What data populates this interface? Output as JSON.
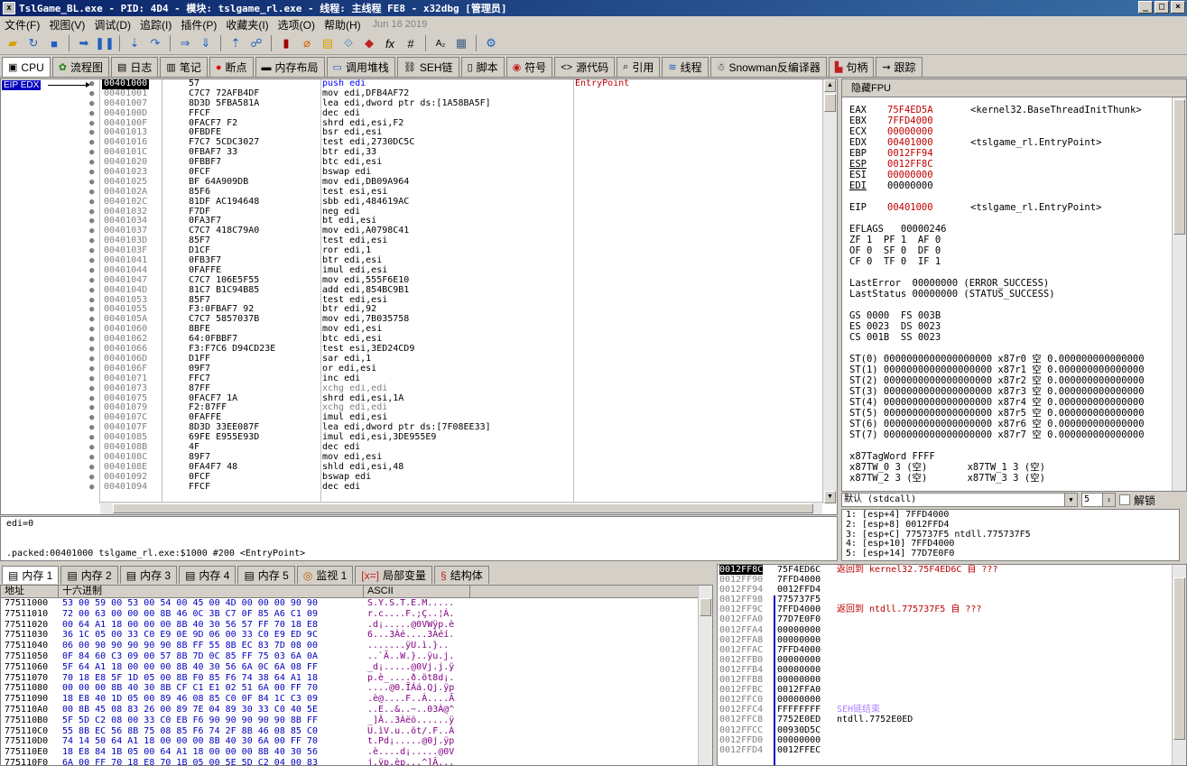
{
  "title": "TslGame_BL.exe - PID: 4D4 - 模块: tslgame_rl.exe - 线程: 主线程 FE8 - x32dbg [管理员]",
  "menu": [
    "文件(F)",
    "视图(V)",
    "调试(D)",
    "追踪(I)",
    "插件(P)",
    "收藏夹(I)",
    "选项(O)",
    "帮助(H)"
  ],
  "menu_date": "Jun 16 2019",
  "tabs": [
    {
      "label": "CPU",
      "icon": "cpu-icon"
    },
    {
      "label": "流程图",
      "icon": "graph-icon"
    },
    {
      "label": "日志",
      "icon": "log-icon"
    },
    {
      "label": "笔记",
      "icon": "notes-icon"
    },
    {
      "label": "断点",
      "icon": "breakpoint-icon"
    },
    {
      "label": "内存布局",
      "icon": "memory-map-icon"
    },
    {
      "label": "调用堆栈",
      "icon": "callstack-icon"
    },
    {
      "label": "SEH链",
      "icon": "seh-icon"
    },
    {
      "label": "脚本",
      "icon": "script-icon"
    },
    {
      "label": "符号",
      "icon": "symbols-icon"
    },
    {
      "label": "源代码",
      "icon": "source-icon"
    },
    {
      "label": "引用",
      "icon": "references-icon"
    },
    {
      "label": "线程",
      "icon": "threads-icon"
    },
    {
      "label": "Snowman反编译器",
      "icon": "snowman-icon"
    },
    {
      "label": "句柄",
      "icon": "handles-icon"
    },
    {
      "label": "跟踪",
      "icon": "trace-icon"
    }
  ],
  "disasm": {
    "eip_label": "EIP EDX",
    "rows": [
      [
        "00401000",
        "57",
        "push edi",
        "EntryPoint"
      ],
      [
        "00401001",
        "C7C7 72AFB4DF",
        "mov edi,DFB4AF72",
        ""
      ],
      [
        "00401007",
        "8D3D 5FBA581A",
        "lea edi,dword ptr ds:[1A58BA5F]",
        ""
      ],
      [
        "0040100D",
        "FFCF",
        "dec edi",
        ""
      ],
      [
        "0040100F",
        "0FACF7 F2",
        "shrd edi,esi,F2",
        ""
      ],
      [
        "00401013",
        "0FBDFE",
        "bsr edi,esi",
        ""
      ],
      [
        "00401016",
        "F7C7 5CDC3027",
        "test edi,2730DC5C",
        ""
      ],
      [
        "0040101C",
        "0FBAF7 33",
        "btr edi,33",
        ""
      ],
      [
        "00401020",
        "0FBBF7",
        "btc edi,esi",
        ""
      ],
      [
        "00401023",
        "0FCF",
        "bswap edi",
        ""
      ],
      [
        "00401025",
        "BF 64A909DB",
        "mov edi,DB09A964",
        ""
      ],
      [
        "0040102A",
        "85F6",
        "test esi,esi",
        ""
      ],
      [
        "0040102C",
        "81DF AC194648",
        "sbb edi,484619AC",
        ""
      ],
      [
        "00401032",
        "F7DF",
        "neg edi",
        ""
      ],
      [
        "00401034",
        "0FA3F7",
        "bt edi,esi",
        ""
      ],
      [
        "00401037",
        "C7C7 418C79A0",
        "mov edi,A0798C41",
        ""
      ],
      [
        "0040103D",
        "85F7",
        "test edi,esi",
        ""
      ],
      [
        "0040103F",
        "D1CF",
        "ror edi,1",
        ""
      ],
      [
        "00401041",
        "0FB3F7",
        "btr edi,esi",
        ""
      ],
      [
        "00401044",
        "0FAFFE",
        "imul edi,esi",
        ""
      ],
      [
        "00401047",
        "C7C7 106E5F55",
        "mov edi,555F6E10",
        ""
      ],
      [
        "0040104D",
        "81C7 B1C94B85",
        "add edi,854BC9B1",
        ""
      ],
      [
        "00401053",
        "85F7",
        "test edi,esi",
        ""
      ],
      [
        "00401055",
        "F3:0FBAF7 92",
        "btr edi,92",
        ""
      ],
      [
        "0040105A",
        "C7C7 5857037B",
        "mov edi,7B035758",
        ""
      ],
      [
        "00401060",
        "8BFE",
        "mov edi,esi",
        ""
      ],
      [
        "00401062",
        "64:0FBBF7",
        "btc edi,esi",
        ""
      ],
      [
        "00401066",
        "F3:F7C6 D94CD23E",
        "test esi,3ED24CD9",
        ""
      ],
      [
        "0040106D",
        "D1FF",
        "sar edi,1",
        ""
      ],
      [
        "0040106F",
        "09F7",
        "or edi,esi",
        ""
      ],
      [
        "00401071",
        "FFC7",
        "inc edi",
        ""
      ],
      [
        "00401073",
        "87FF",
        "xchg edi,edi",
        ""
      ],
      [
        "00401075",
        "0FACF7 1A",
        "shrd edi,esi,1A",
        ""
      ],
      [
        "00401079",
        "F2:87FF",
        "xchg edi,edi",
        ""
      ],
      [
        "0040107C",
        "0FAFFE",
        "imul edi,esi",
        ""
      ],
      [
        "0040107F",
        "8D3D 33EE087F",
        "lea edi,dword ptr ds:[7F08EE33]",
        ""
      ],
      [
        "00401085",
        "69FE E955E93D",
        "imul edi,esi,3DE955E9",
        ""
      ],
      [
        "0040108B",
        "4F",
        "dec edi",
        ""
      ],
      [
        "0040108C",
        "89F7",
        "mov edi,esi",
        ""
      ],
      [
        "0040108E",
        "0FA4F7 48",
        "shld edi,esi,48",
        ""
      ],
      [
        "00401092",
        "0FCF",
        "bswap edi",
        ""
      ],
      [
        "00401094",
        "FFCF",
        "dec edi",
        ""
      ]
    ]
  },
  "info": {
    "line1": "edi=0",
    "line2": ".packed:00401000 tslgame_rl.exe:$1000 #200 <EntryPoint>"
  },
  "regs": {
    "header": "隐藏FPU",
    "gp": [
      [
        "EAX",
        "75F4ED5A",
        "<kernel32.BaseThreadInitThunk>"
      ],
      [
        "EBX",
        "7FFD4000",
        ""
      ],
      [
        "ECX",
        "00000000",
        ""
      ],
      [
        "EDX",
        "00401000",
        "<tslgame_rl.EntryPoint>"
      ],
      [
        "EBP",
        "0012FF94",
        ""
      ],
      [
        "ESP",
        "0012FF8C",
        ""
      ],
      [
        "ESI",
        "00000000",
        ""
      ],
      [
        "EDI",
        "00000000",
        ""
      ]
    ],
    "eip": [
      "EIP",
      "00401000",
      "<tslgame_rl.EntryPoint>"
    ],
    "eflags": "EFLAGS   00000246",
    "flags1": "ZF 1  PF 1  AF 0",
    "flags2": "OF 0  SF 0  DF 0",
    "flags3": "CF 0  TF 0  IF 1",
    "lasterror": "LastError  00000000 (ERROR_SUCCESS)",
    "laststatus": "LastStatus 00000000 (STATUS_SUCCESS)",
    "seg1": "GS 0000  FS 003B",
    "seg2": "ES 0023  DS 0023",
    "seg3": "CS 001B  SS 0023",
    "st": [
      "ST(0) 0000000000000000000 x87r0 空 0.000000000000000",
      "ST(1) 0000000000000000000 x87r1 空 0.000000000000000",
      "ST(2) 0000000000000000000 x87r2 空 0.000000000000000",
      "ST(3) 0000000000000000000 x87r3 空 0.000000000000000",
      "ST(4) 0000000000000000000 x87r4 空 0.000000000000000",
      "ST(5) 0000000000000000000 x87r5 空 0.000000000000000",
      "ST(6) 0000000000000000000 x87r6 空 0.000000000000000",
      "ST(7) 0000000000000000000 x87r7 空 0.000000000000000"
    ],
    "tagword": "x87TagWord FFFF",
    "tw1": "x87TW_0 3 (空)       x87TW_1 3 (空)",
    "tw2": "x87TW_2 3 (空)       x87TW_3 3 (空)"
  },
  "callconv": {
    "select": "默认 (stdcall)",
    "num": "5",
    "unlock": "解锁"
  },
  "stackargs": [
    "1: [esp+4] 7FFD4000",
    "2: [esp+8] 0012FFD4",
    "3: [esp+C] 775737F5 ntdll.775737F5",
    "4: [esp+10] 7FFD4000",
    "5: [esp+14] 77D7E0F0"
  ],
  "btabs": [
    {
      "label": "内存 1",
      "icon": "dump-icon"
    },
    {
      "label": "内存 2",
      "icon": "dump-icon"
    },
    {
      "label": "内存 3",
      "icon": "dump-icon"
    },
    {
      "label": "内存 4",
      "icon": "dump-icon"
    },
    {
      "label": "内存 5",
      "icon": "dump-icon"
    },
    {
      "label": "监视 1",
      "icon": "watch-icon"
    },
    {
      "label": "局部变量",
      "icon": "locals-icon"
    },
    {
      "label": "结构体",
      "icon": "struct-icon"
    }
  ],
  "dump": {
    "headers": [
      "地址",
      "十六进制",
      "ASCII"
    ],
    "rows": [
      [
        "77511000",
        "53 00 59 00 53 00 54 00 45 00 4D 00 00 00 90 90",
        "S.Y.S.T.E.M....."
      ],
      [
        "77511010",
        "72 00 63 00 00 00 8B 46 0C 3B C7 0F 85 A6 C1 09",
        "r.c....F.;Ç..¦Á."
      ],
      [
        "77511020",
        "00 64 A1 18 00 00 00 8B 40 30 56 57 FF 70 18 E8",
        ".d¡.....@0VWÿp.è"
      ],
      [
        "77511030",
        "36 1C 05 00 33 C0 E9 0E 9D 06 00 33 C0 E9 ED 9C",
        "6...3Àé....3Àéí."
      ],
      [
        "77511040",
        "06 00 90 90 90 90 90 8B FF 55 8B EC 83 7D 08 00",
        ".......ÿU.ì.}.."
      ],
      [
        "77511050",
        "0F 84 60 C3 09 00 57 8B 7D 0C 85 FF 75 03 6A 0A",
        "..`Ã..W.}..ÿu.j."
      ],
      [
        "77511060",
        "5F 64 A1 18 00 00 00 8B 40 30 56 6A 0C 6A 08 FF",
        "_d¡.....@0Vj.j.ÿ"
      ],
      [
        "77511070",
        "70 18 E8 5F 1D 05 00 8B F0 85 F6 74 38 64 A1 18",
        "p.è_....ð.öt8d¡."
      ],
      [
        "77511080",
        "00 00 00 8B 40 30 8B CF C1 E1 02 51 6A 00 FF 70",
        "....@0.ÏÁá.Qj.ÿp"
      ],
      [
        "77511090",
        "18 E8 40 1D 05 00 89 46 08 85 C0 0F 84 1C C3 09",
        ".è@....F..À....Ã"
      ],
      [
        "775110A0",
        "00 8B 45 08 83 26 00 89 7E 04 89 30 33 C0 40 5E",
        "..E..&..~..03À@^"
      ],
      [
        "775110B0",
        "5F 5D C2 08 00 33 C0 EB F6 90 90 90 90 90 8B FF",
        "_]Â..3Àëö......ÿ"
      ],
      [
        "775110C0",
        "55 8B EC 56 8B 75 08 85 F6 74 2F 8B 46 08 85 C0",
        "U.ìV.u..öt/.F..À"
      ],
      [
        "775110D0",
        "74 14 50 64 A1 18 00 00 00 8B 40 30 6A 00 FF 70",
        "t.Pd¡.....@0j.ÿp"
      ],
      [
        "775110E0",
        "18 E8 84 1B 05 00 64 A1 18 00 00 00 8B 40 30 56",
        ".è....d¡.....@0V"
      ],
      [
        "775110F0",
        "6A 00 FF 70 18 E8 70 1B 05 00 5E 5D C2 04 00 83",
        "j.ÿp.èp...^]Â..."
      ],
      [
        "77511100",
        "CF 02 F9 47 9F 06 00 83 C0 08 F9 51 9F 06 00 33",
        "Ï.ùG....À.ùQ...3"
      ]
    ]
  },
  "stack": [
    [
      "0012FF8C",
      "75F4ED6C",
      "返回到 kernel32.75F4ED6C 自 ???"
    ],
    [
      "0012FF90",
      "7FFD4000",
      ""
    ],
    [
      "0012FF94",
      "0012FFD4",
      ""
    ],
    [
      "0012FF98",
      "775737F5",
      ""
    ],
    [
      "0012FF9C",
      "7FFD4000",
      "返回到 ntdll.775737F5 自 ???"
    ],
    [
      "0012FFA0",
      "77D7E0F0",
      ""
    ],
    [
      "0012FFA4",
      "00000000",
      ""
    ],
    [
      "0012FFA8",
      "00000000",
      ""
    ],
    [
      "0012FFAC",
      "7FFD4000",
      ""
    ],
    [
      "0012FFB0",
      "00000000",
      ""
    ],
    [
      "0012FFB4",
      "00000000",
      ""
    ],
    [
      "0012FFB8",
      "00000000",
      ""
    ],
    [
      "0012FFBC",
      "0012FFA0",
      ""
    ],
    [
      "0012FFC0",
      "00000000",
      ""
    ],
    [
      "0012FFC4",
      "FFFFFFFF",
      "SEH链结束"
    ],
    [
      "0012FFC8",
      "7752E0ED",
      "ntdll.7752E0ED"
    ],
    [
      "0012FFCC",
      "00930D5C",
      ""
    ],
    [
      "0012FFD0",
      "00000000",
      ""
    ],
    [
      "0012FFD4",
      "0012FFEC",
      ""
    ]
  ]
}
